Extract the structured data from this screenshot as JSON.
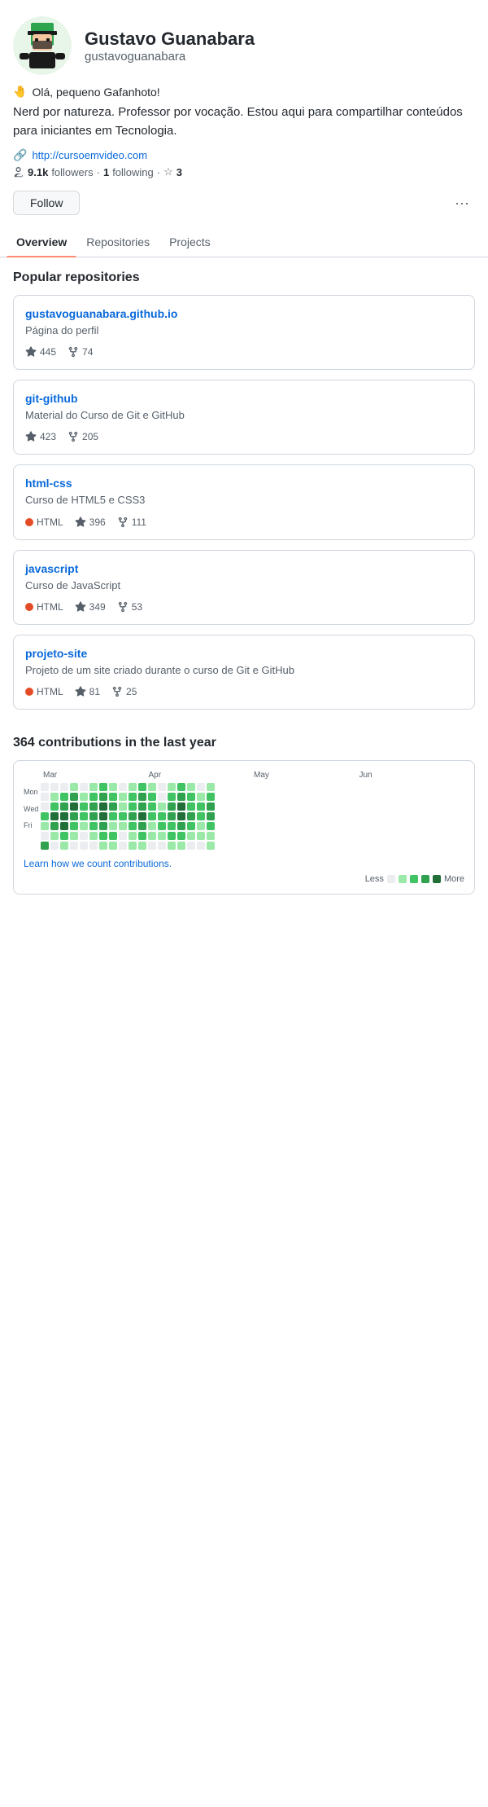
{
  "profile": {
    "display_name": "Gustavo Guanabara",
    "username": "gustavoguanabara",
    "greeting_emoji": "🤚",
    "greeting_text": "Olá, pequeno Gafanhoto!",
    "bio": "Nerd por natureza. Professor por vocação. Estou aqui para compartilhar conteúdos para iniciantes em Tecnologia.",
    "website": "http://cursoemvideo.com",
    "followers_count": "9.1k",
    "following_count": "1",
    "stars_count": "3"
  },
  "actions": {
    "follow_label": "Follow",
    "more_label": "···"
  },
  "nav": {
    "tabs": [
      {
        "label": "Overview",
        "active": true
      },
      {
        "label": "Repositories",
        "active": false
      },
      {
        "label": "Projects",
        "active": false
      }
    ]
  },
  "popular_repos": {
    "title": "Popular repositories",
    "repos": [
      {
        "name": "gustavoguanabara.github.io",
        "description": "Página do perfil",
        "language": null,
        "lang_color": null,
        "stars": "445",
        "forks": "74"
      },
      {
        "name": "git-github",
        "description": "Material do Curso de Git e GitHub",
        "language": null,
        "lang_color": null,
        "stars": "423",
        "forks": "205"
      },
      {
        "name": "html-css",
        "description": "Curso de HTML5 e CSS3",
        "language": "HTML",
        "lang_color": "#e34c26",
        "stars": "396",
        "forks": "111"
      },
      {
        "name": "javascript",
        "description": "Curso de JavaScript",
        "language": "HTML",
        "lang_color": "#e34c26",
        "stars": "349",
        "forks": "53"
      },
      {
        "name": "projeto-site",
        "description": "Projeto de um site criado durante o curso de Git e GitHub",
        "language": "HTML",
        "lang_color": "#e34c26",
        "stars": "81",
        "forks": "25"
      }
    ]
  },
  "contributions": {
    "title": "364 contributions in the last year",
    "month_labels": [
      "Mar",
      "Apr",
      "May",
      "Jun"
    ],
    "learn_link_text": "Learn how we count contributions.",
    "legend": {
      "less_label": "Less",
      "more_label": "More"
    }
  },
  "icons": {
    "link": "🔗",
    "person": "👤",
    "star": "☆",
    "fork": "⑂"
  }
}
